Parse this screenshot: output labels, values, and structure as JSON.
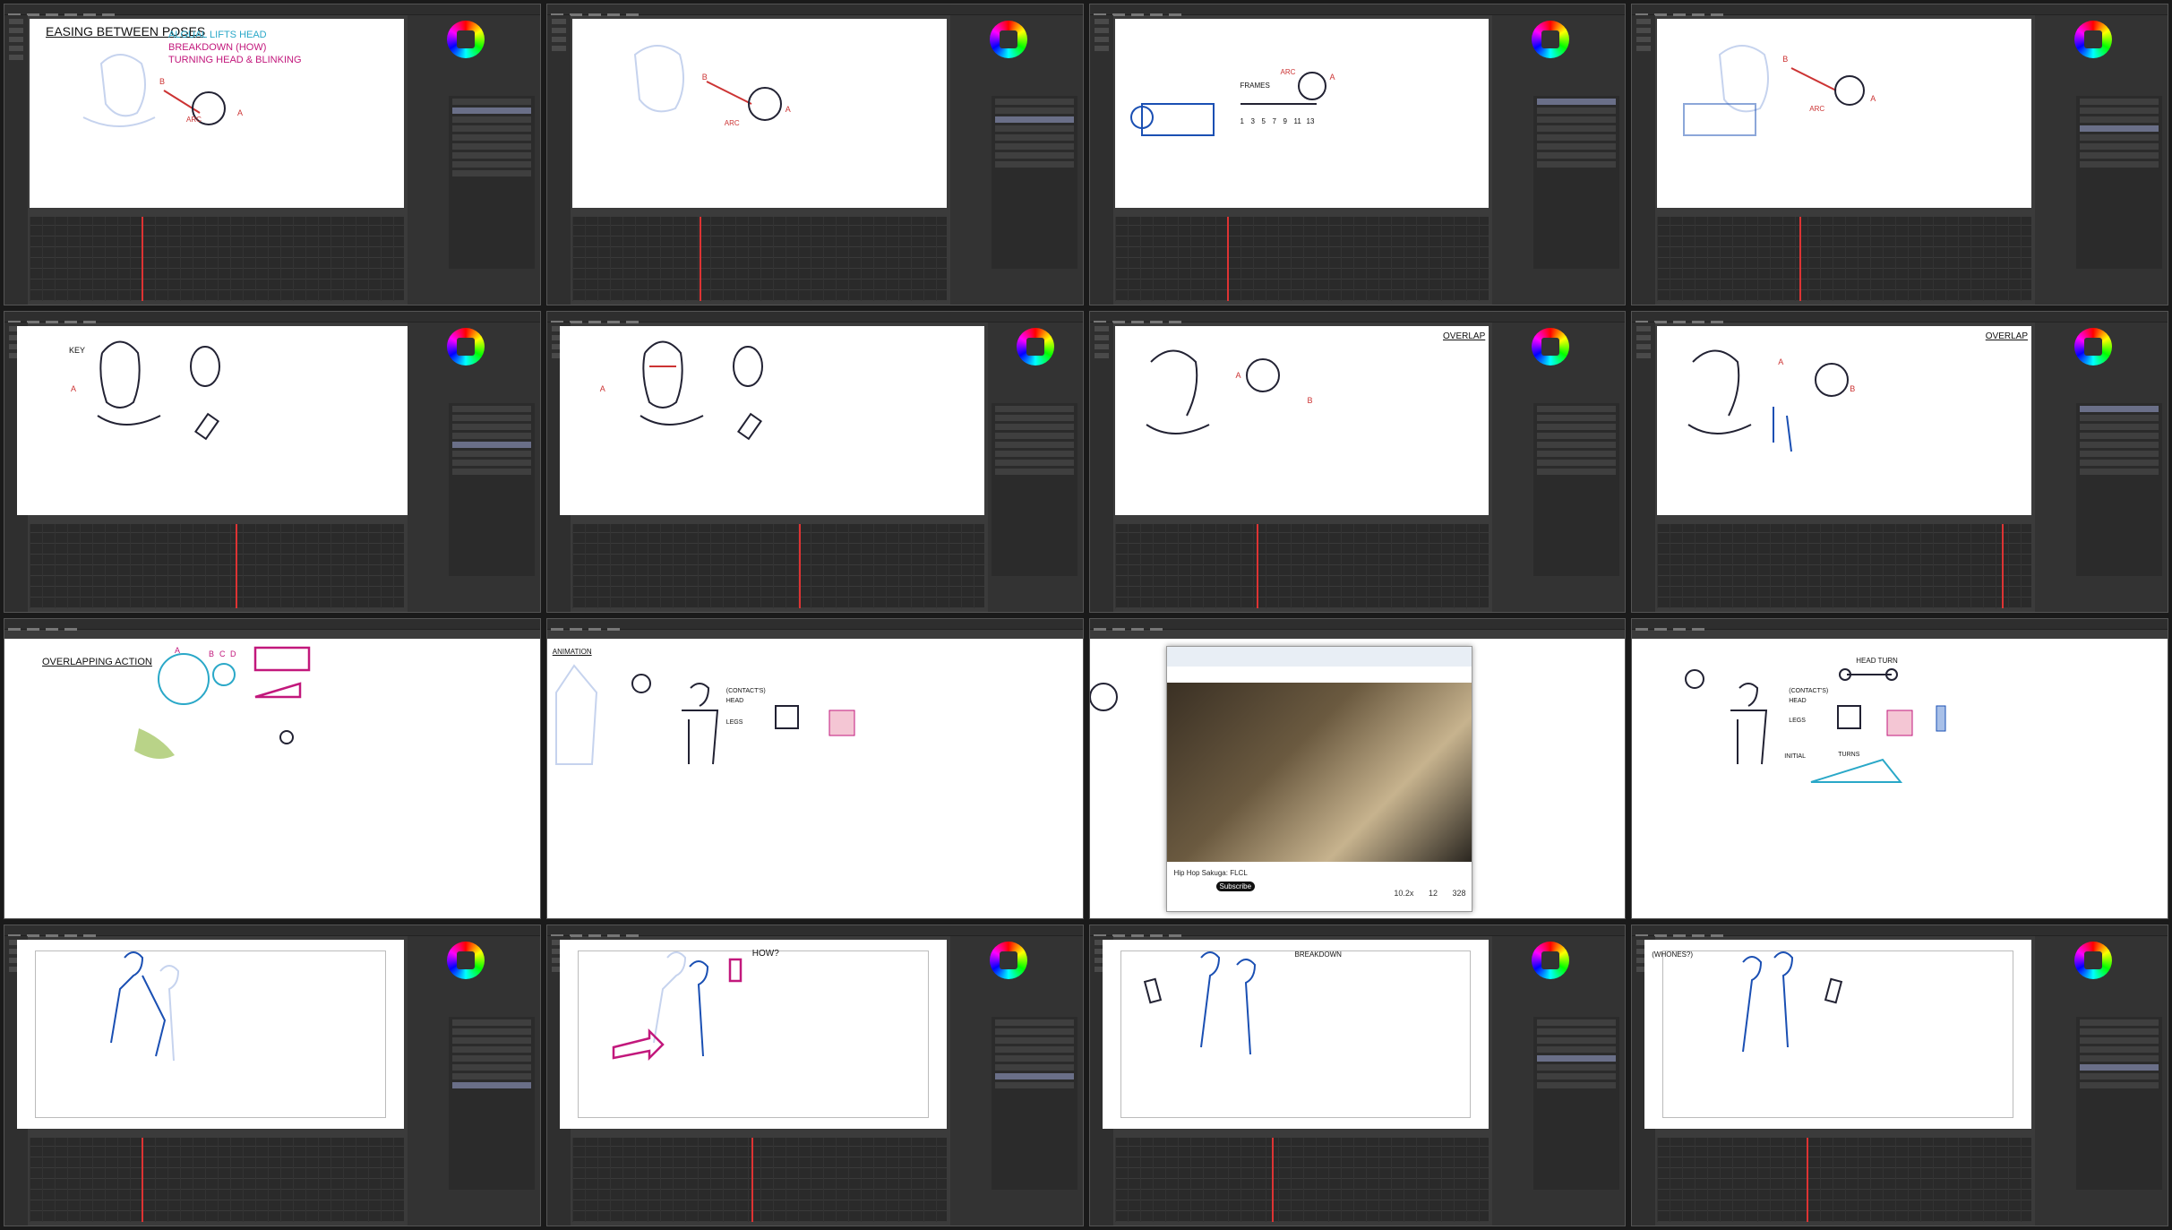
{
  "screens": [
    {
      "id": "s1",
      "layout": "app",
      "notes": [
        "EASING BETWEEN POSES",
        "ALGUAL LIFTS HEAD",
        "BREAKDOWN (HOW)",
        "TURNING HEAD & BLINKING",
        "B",
        "A",
        "ARC"
      ]
    },
    {
      "id": "s2",
      "layout": "app",
      "notes": [
        "B",
        "A",
        "ARC"
      ]
    },
    {
      "id": "s3",
      "layout": "app",
      "notes": [
        "FRAMES",
        "1",
        "3",
        "5",
        "7",
        "9",
        "11",
        "13",
        "A",
        "ARC"
      ]
    },
    {
      "id": "s4",
      "layout": "app",
      "notes": [
        "B",
        "A",
        "ARC"
      ]
    },
    {
      "id": "s5",
      "layout": "app",
      "notes": [
        "KEY",
        "A"
      ]
    },
    {
      "id": "s6",
      "layout": "app",
      "notes": [
        "A"
      ]
    },
    {
      "id": "s7",
      "layout": "app",
      "notes": [
        "OVERLAP",
        "A",
        "B"
      ]
    },
    {
      "id": "s8",
      "layout": "app",
      "notes": [
        "OVERLAP",
        "A",
        "B"
      ]
    },
    {
      "id": "s9",
      "layout": "full",
      "notes": [
        "OVERLAPPING ACTION",
        "A",
        "B",
        "C",
        "D"
      ]
    },
    {
      "id": "s10",
      "layout": "full",
      "notes": [
        "ANIMATION",
        "(CONTACT'S)",
        "HEAD",
        "LEGS"
      ]
    },
    {
      "id": "s11",
      "layout": "full",
      "video": {
        "title": "Hip Hop Sakuga: FLCL",
        "subscribe": "Subscribe",
        "stats": [
          "10.2x",
          "12",
          "328"
        ]
      }
    },
    {
      "id": "s12",
      "layout": "full",
      "notes": [
        "HEAD TURN",
        "(CONTACT'S)",
        "HEAD",
        "LEGS",
        "INITIAL",
        "TURNS"
      ]
    },
    {
      "id": "s13",
      "layout": "app",
      "notes": []
    },
    {
      "id": "s14",
      "layout": "app",
      "notes": [
        "HOW?"
      ]
    },
    {
      "id": "s15",
      "layout": "app",
      "notes": [
        "BREAKDOWN"
      ]
    },
    {
      "id": "s16",
      "layout": "app",
      "notes": [
        "(WHONES?)"
      ]
    }
  ],
  "colors": {
    "app_bg": "#3b3b3b",
    "canvas": "#ffffff",
    "playhead": "#dd3333",
    "accent": "#6a6f88"
  }
}
